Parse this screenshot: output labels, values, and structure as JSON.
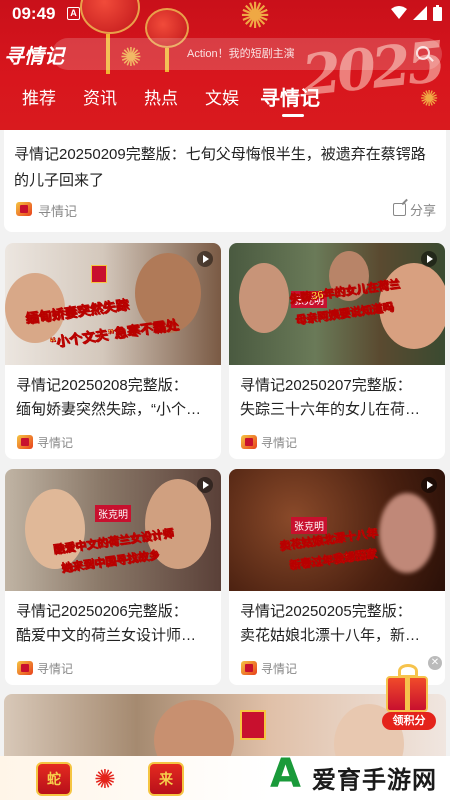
{
  "status_bar": {
    "time": "09:49",
    "notif_glyph": "A"
  },
  "header": {
    "logo": "寻情记",
    "year_deco": "2025",
    "search_placeholder": "Action！我的短剧主演",
    "tabs": [
      {
        "label": "推荐"
      },
      {
        "label": "资讯"
      },
      {
        "label": "热点"
      },
      {
        "label": "文娱"
      },
      {
        "label": "寻情记",
        "active": true
      }
    ]
  },
  "top_card": {
    "title": "寻情记20250209完整版：七旬父母悔恨半生，被遗弃在蔡锷路的儿子回来了",
    "source": "寻情记",
    "share_label": "分享"
  },
  "cards": [
    {
      "title_line1": "寻情记20250208完整版：",
      "title_line2": "缅甸娇妻突然失踪，“小个…",
      "source": "寻情记",
      "thumb_caption1": "缅甸娇妻突然失踪",
      "thumb_caption2": "“小个文夫”急寒不霸处",
      "thumb_colors": [
        "#d8d0c8",
        "#8a6a50"
      ]
    },
    {
      "title_line1": "寻情记20250207完整版：",
      "title_line2": "失踪三十六年的女儿在荷…",
      "source": "寻情记",
      "thumb_caption1": "失踪36年的女儿在荷兰",
      "thumb_caption2": "母亲阿姨要说知道吗",
      "thumb_colors": [
        "#5a6a50",
        "#c89070"
      ]
    },
    {
      "title_line1": "寻情记20250206完整版：",
      "title_line2": "酷爱中文的荷兰女设计师…",
      "source": "寻情记",
      "thumb_caption1": "酷爱中文的荷兰女设计师",
      "thumb_caption2": "她来到中国寻找故乡",
      "thumb_colors": [
        "#b8a898",
        "#6a4a40"
      ]
    },
    {
      "title_line1": "寻情记20250205完整版：",
      "title_line2": "卖花姑娘北漂十八年，新…",
      "source": "寻情记",
      "thumb_caption1": "卖花姑娘北漂十八年",
      "thumb_caption2": "新春过年我想回家",
      "thumb_colors": [
        "#5a3020",
        "#a87060"
      ]
    }
  ],
  "gift": {
    "label": "领积分"
  },
  "bottom_banner": {
    "zodiac1": "蛇",
    "zodiac2": "来"
  },
  "watermark": {
    "logo": "A",
    "text": "爱育手游网"
  },
  "colors": {
    "primary_red": "#d8161d",
    "watermark_green": "#1a9a3a"
  },
  "icons": [
    "wifi-icon",
    "signal-icon",
    "battery-icon",
    "search-icon",
    "share-icon",
    "play-icon",
    "close-icon",
    "gift-icon"
  ]
}
